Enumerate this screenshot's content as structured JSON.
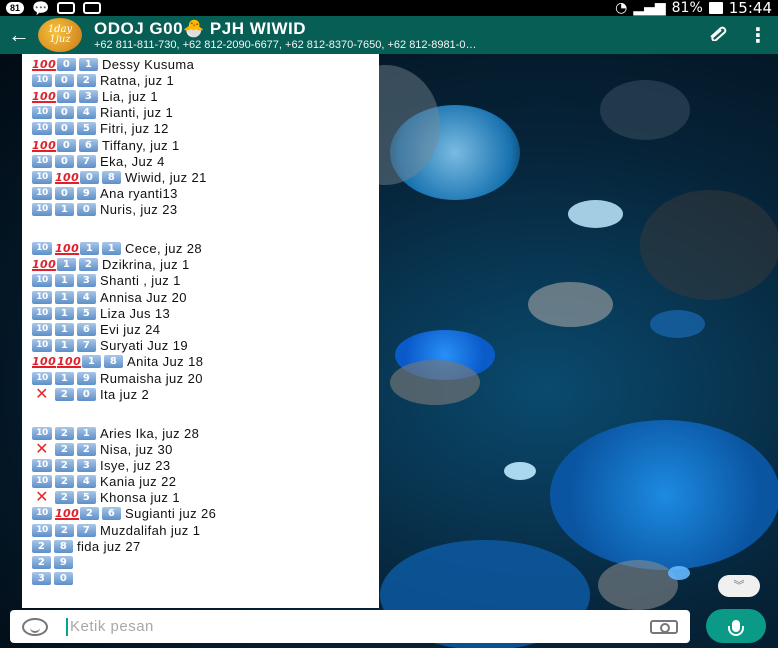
{
  "status_bar": {
    "notification_badge": "81",
    "battery": "81%",
    "time": "15:44"
  },
  "header": {
    "back_icon": "arrow-left-icon",
    "avatar_text": "1day 1juz",
    "group_name": "ODOJ  G00🐣 PJH WIWID",
    "participants": "+62 811-811-730, +62 812-2090-6677, +62 812-8370-7650, +62 812-8981-0…"
  },
  "messages": [
    {
      "marks": [
        "100",
        "0",
        "1"
      ],
      "text": "Dessy Kusuma"
    },
    {
      "marks": [
        "10",
        "0",
        "2"
      ],
      "text": "Ratna, juz 1"
    },
    {
      "marks": [
        "100",
        "0",
        "3"
      ],
      "text": "Lia, juz 1"
    },
    {
      "marks": [
        "10",
        "0",
        "4"
      ],
      "text": "Rianti, juz 1"
    },
    {
      "marks": [
        "10",
        "0",
        "5"
      ],
      "text": "Fitri, juz 12"
    },
    {
      "marks": [
        "100",
        "0",
        "6"
      ],
      "text": "Tiffany, juz 1"
    },
    {
      "marks": [
        "10",
        "0",
        "7"
      ],
      "text": "Eka, Juz 4"
    },
    {
      "marks": [
        "10",
        "100",
        "0",
        "8"
      ],
      "text": "Wiwid, juz 21"
    },
    {
      "marks": [
        "10",
        "0",
        "9"
      ],
      "text": "Ana ryanti13"
    },
    {
      "marks": [
        "10",
        "1",
        "0"
      ],
      "text": "Nuris, juz 23"
    },
    {
      "blank": true
    },
    {
      "marks": [
        "10",
        "100",
        "1",
        "1"
      ],
      "text": "Cece, juz 28"
    },
    {
      "marks": [
        "100",
        "1",
        "2"
      ],
      "text": "Dzikrina, juz 1"
    },
    {
      "marks": [
        "10",
        "1",
        "3"
      ],
      "text": "Shanti , juz 1"
    },
    {
      "marks": [
        "10",
        "1",
        "4"
      ],
      "text": "Annisa Juz 20"
    },
    {
      "marks": [
        "10",
        "1",
        "5"
      ],
      "text": "Liza Jus 13"
    },
    {
      "marks": [
        "10",
        "1",
        "6"
      ],
      "text": "Evi juz 24"
    },
    {
      "marks": [
        "10",
        "1",
        "7"
      ],
      "text": "Suryati Juz 19"
    },
    {
      "marks": [
        "100",
        "100",
        "1",
        "8"
      ],
      "text": "Anita Juz 18"
    },
    {
      "marks": [
        "10",
        "1",
        "9"
      ],
      "text": "Rumaisha juz 20"
    },
    {
      "marks": [
        "x",
        "2",
        "0"
      ],
      "text": "Ita juz 2"
    },
    {
      "blank": true
    },
    {
      "marks": [
        "10",
        "2",
        "1"
      ],
      "text": "Aries Ika, juz 28"
    },
    {
      "marks": [
        "x",
        "2",
        "2"
      ],
      "text": "Nisa,  juz 30"
    },
    {
      "marks": [
        "10",
        "2",
        "3"
      ],
      "text": "Isye, juz 23"
    },
    {
      "marks": [
        "10",
        "2",
        "4"
      ],
      "text": "Kania juz 22"
    },
    {
      "marks": [
        "x",
        "2",
        "5"
      ],
      "text": "Khonsa juz 1"
    },
    {
      "marks": [
        "10",
        "100",
        "2",
        "6"
      ],
      "text": "Sugianti juz 26"
    },
    {
      "marks": [
        "10",
        "2",
        "7"
      ],
      "text": "Muzdalifah juz 1"
    },
    {
      "marks": [
        "2",
        "8"
      ],
      "text": " fida juz 27"
    },
    {
      "marks": [
        "2",
        "9"
      ],
      "text": ""
    },
    {
      "marks": [
        "3",
        "0"
      ],
      "text": ""
    }
  ],
  "input": {
    "placeholder": "Ketik pesan"
  },
  "icons": {
    "attach": "paperclip-icon",
    "more": "more-vertical-icon",
    "emoji": "emoji-icon",
    "camera": "camera-icon",
    "mic": "mic-icon",
    "scroll": "scroll-down-icon"
  },
  "colors": {
    "appbar": "#075e54",
    "accent": "#0b9a86",
    "red_mark": "#e0202a"
  }
}
